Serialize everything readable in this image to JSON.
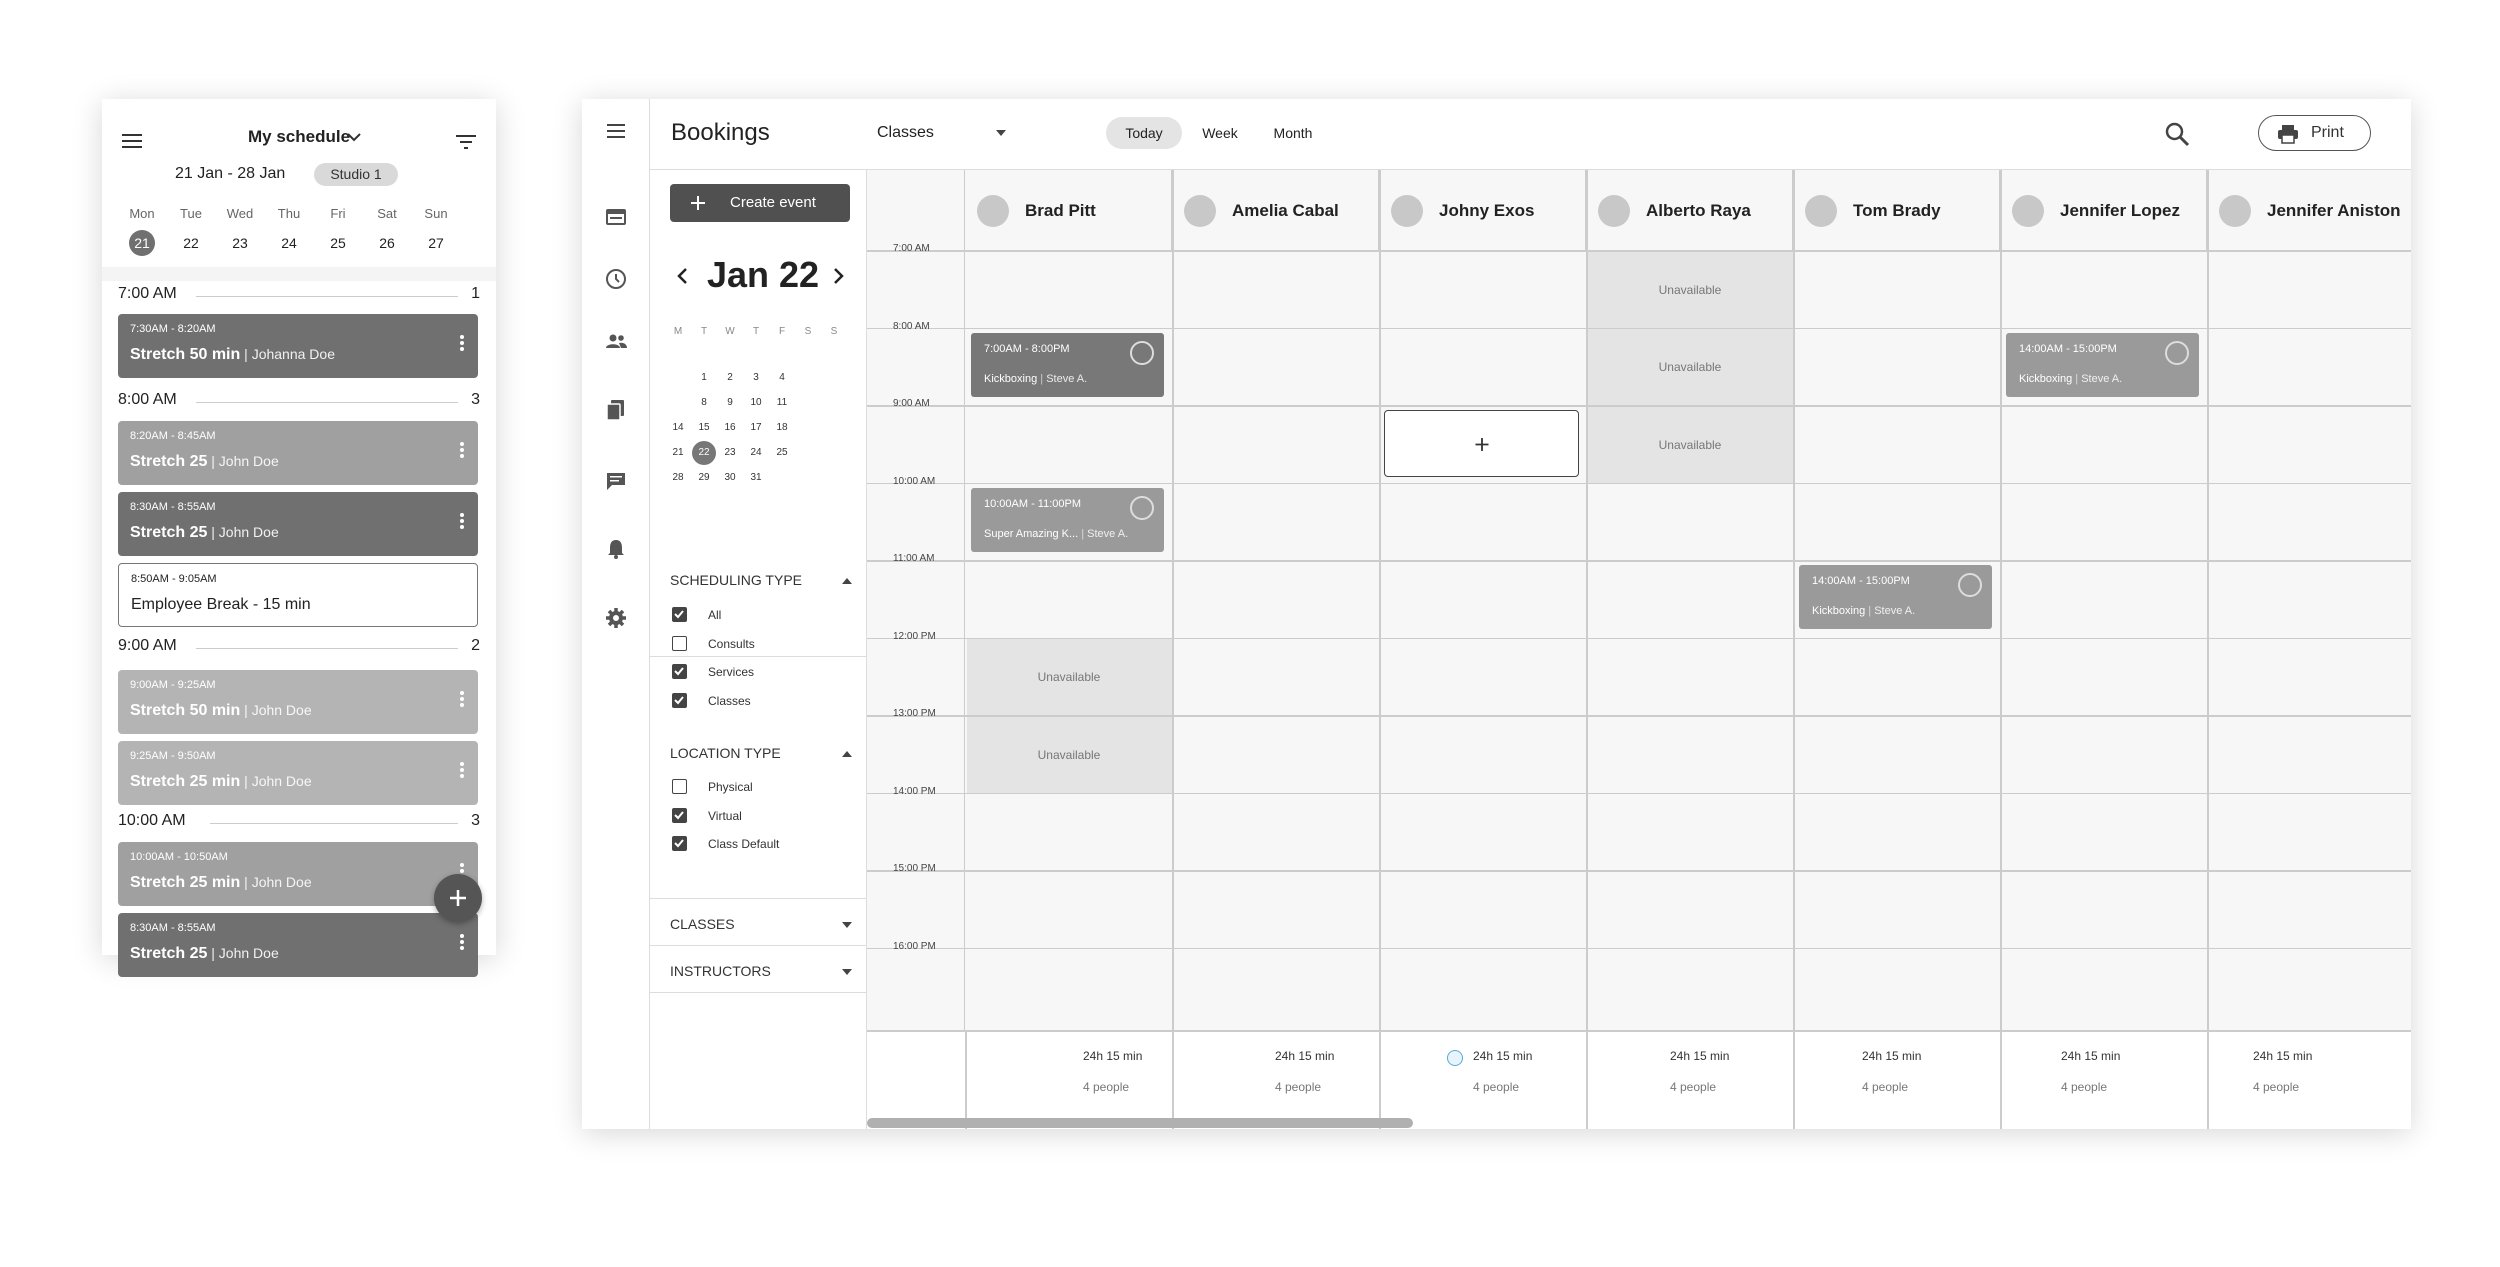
{
  "mobile": {
    "title": "My schedule",
    "range": "21 Jan - 28 Jan",
    "studio": "Studio 1",
    "days": [
      {
        "name": "Mon",
        "date": "21",
        "selected": true
      },
      {
        "name": "Tue",
        "date": "22"
      },
      {
        "name": "Wed",
        "date": "23"
      },
      {
        "name": "Thu",
        "date": "24"
      },
      {
        "name": "Fri",
        "date": "25"
      },
      {
        "name": "Sat",
        "date": "26"
      },
      {
        "name": "Sun",
        "date": "27"
      }
    ],
    "hours": [
      {
        "label": "7:00 AM",
        "count": "1"
      },
      {
        "label": "8:00 AM",
        "count": "3"
      },
      {
        "label": "9:00 AM",
        "count": "2"
      },
      {
        "label": "10:00 AM",
        "count": "3"
      }
    ],
    "cards": [
      {
        "time": "7:30AM - 8:20AM",
        "name": "Stretch 50 min",
        "sep": " | ",
        "person": "Johanna Doe"
      },
      {
        "time": "8:20AM - 8:45AM",
        "name": "Stretch 25",
        "sep": " | ",
        "person": "John Doe"
      },
      {
        "time": "8:30AM - 8:55AM",
        "name": "Stretch 25",
        "sep": " | ",
        "person": "John Doe"
      },
      {
        "time": "8:50AM - 9:05AM",
        "name": "Employee Break - 15 min",
        "sep": "",
        "person": ""
      },
      {
        "time": "9:00AM - 9:25AM",
        "name": "Stretch 50 min",
        "sep": " | ",
        "person": "John Doe"
      },
      {
        "time": "9:25AM - 9:50AM",
        "name": "Stretch 25 min",
        "sep": " | ",
        "person": "John Doe"
      },
      {
        "time": "10:00AM - 10:50AM",
        "name": "Stretch 25 min",
        "sep": " | ",
        "person": "John Doe"
      },
      {
        "time": "8:30AM - 8:55AM",
        "name": "Stretch 25",
        "sep": " | ",
        "person": "John Doe"
      }
    ]
  },
  "desk": {
    "title": "Bookings",
    "select": "Classes",
    "views": [
      "Today",
      "Week",
      "Month"
    ],
    "active_view": "Today",
    "print": "Print",
    "create": "Create event",
    "month": "Jan 22",
    "weekdays": [
      "M",
      "T",
      "W",
      "T",
      "F",
      "S",
      "S"
    ],
    "cal_rows": [
      [
        "",
        "1",
        "2",
        "3",
        "4",
        "",
        ""
      ],
      [
        "",
        "8",
        "9",
        "10",
        "11",
        "",
        ""
      ],
      [
        "14",
        "15",
        "16",
        "17",
        "18",
        "",
        ""
      ],
      [
        "21",
        "22",
        "23",
        "24",
        "25",
        "",
        ""
      ],
      [
        "28",
        "29",
        "30",
        "31",
        "",
        "",
        ""
      ]
    ],
    "cal_selected": "22",
    "sched_title": "SCHEDULING TYPE",
    "sched_items": [
      {
        "label": "All",
        "checked": true
      },
      {
        "label": "Consults",
        "checked": false
      },
      {
        "label": "Services",
        "checked": true
      },
      {
        "label": "Classes",
        "checked": true
      }
    ],
    "loc_title": "LOCATION TYPE",
    "loc_items": [
      {
        "label": "Physical",
        "checked": false
      },
      {
        "label": "Virtual",
        "checked": true
      },
      {
        "label": "Class Default",
        "checked": true
      }
    ],
    "classes_title": "CLASSES",
    "instructors_title": "INSTRUCTORS",
    "times": [
      "7:00 AM",
      "8:00 AM",
      "9:00 AM",
      "10:00 AM",
      "11:00 AM",
      "12:00 PM",
      "13:00 PM",
      "14:00 PM",
      "15:00 PM",
      "16:00 PM"
    ],
    "staff": [
      "Brad Pitt",
      "Amelia Cabal",
      "Johny Exos",
      "Alberto Raya",
      "Tom Brady",
      "Jennifer Lopez",
      "Jennifer Aniston"
    ],
    "unavailable": "Unavailable",
    "events": [
      {
        "time": "7:00AM - 8:00PM",
        "name": "Kickboxing",
        "who": "Steve A."
      },
      {
        "time": "10:00AM - 11:00PM",
        "name": "Super Amazing K...",
        "who": "Steve A."
      },
      {
        "time": "14:00AM - 15:00PM",
        "name": "Kickboxing",
        "who": "Steve A."
      },
      {
        "time": "14:00AM - 15:00PM",
        "name": "Kickboxing",
        "who": "Steve A."
      }
    ],
    "totals": [
      "24h 15 min",
      "24h 15 min",
      "24h 15 min",
      "24h 15 min",
      "24h 15 min",
      "24h 15 min",
      "24h 15 min"
    ],
    "people": [
      "4 people",
      "4 people",
      "4 people",
      "4 people",
      "4 people",
      "4 people",
      "4 people"
    ]
  }
}
